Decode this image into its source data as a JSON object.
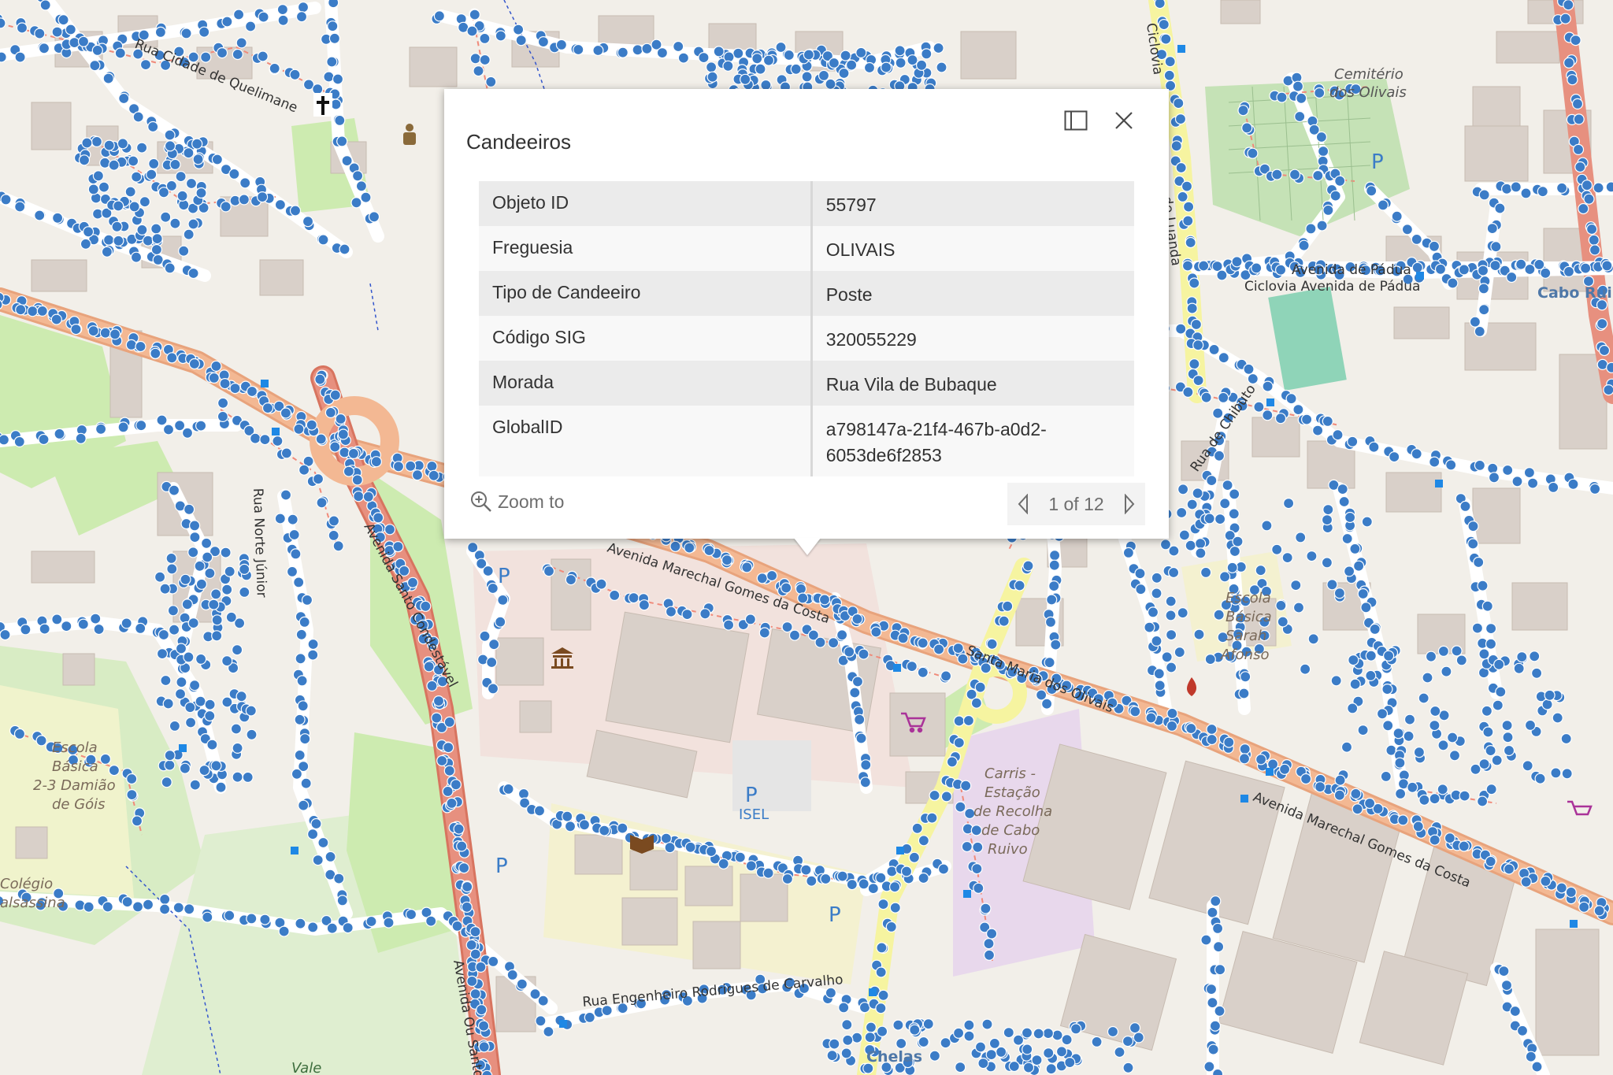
{
  "popup": {
    "title": "Candeeiros",
    "dock_icon": "dock-icon",
    "close_icon": "close-icon",
    "fields": [
      {
        "key": "Objeto ID",
        "value": "55797"
      },
      {
        "key": "Freguesia",
        "value": "OLIVAIS"
      },
      {
        "key": "Tipo de Candeeiro",
        "value": "Poste"
      },
      {
        "key": "Código SIG",
        "value": "320055229"
      },
      {
        "key": "Morada",
        "value": "Rua Vila de Bubaque"
      },
      {
        "key": "GlobalID",
        "value": "a798147a-21f4-467b-a0d2-6053de6f2853"
      }
    ],
    "zoom_to_label": "Zoom to",
    "zoom_icon": "zoom-in-icon",
    "pager_text": "1 of 12",
    "prev_icon": "chevron-left-icon",
    "next_icon": "chevron-right-icon"
  },
  "map": {
    "labels": {
      "cemiterio": "Cemitério",
      "cemiterio2": "dos Olivais",
      "escola_sarah_1": "Escola",
      "escola_sarah_2": "Básica",
      "escola_sarah_3": "Sarah",
      "escola_sarah_4": "Afonso",
      "escola_damiao_1": "Escola",
      "escola_damiao_2": "Básica",
      "escola_damiao_3": "2-3 Damião",
      "escola_damiao_4": "de Góis",
      "colegio_1": "Colégio",
      "colegio_2": "alsassina",
      "carris_1": "Carris -",
      "carris_2": "Estação",
      "carris_3": "de Recolha",
      "carris_4": "de Cabo",
      "carris_5": "Ruivo",
      "isel": "ISEL",
      "cabo_ruivo": "Cabo Rui",
      "chelas": "Chelas",
      "vale": "Vale",
      "av_padua": "Avenida de Pádua",
      "ciclovia_padua": "Ciclovia Avenida de Pádua",
      "av_marechal_1": "Avenida Marechal Gomes da Costa",
      "av_marechal_2": "Avenida Marechal Gomes da Costa",
      "rua_eng": "Rua Engenheiro Rodrigues de Carvalho",
      "av_santo_condestavel": "Avenida Santo Condestável",
      "av_ou_santo": "Avenida Ou Santo",
      "rua_norte_junior": "Rua Norte Júnior",
      "rua_chibuto": "Rua de Chibuto",
      "rua_quelimane": "Rua Cidade de Quelimane",
      "ciclovia_luanda": "Ciclovia",
      "av_luanda": "de Luanda",
      "santa_maria_olivais": "Santa Maria dos Olivais",
      "parking": "P"
    },
    "colors": {
      "background": "#f2efe9",
      "building": "#d9d0c9",
      "park": "#cdebb0",
      "primary_road": "#f3b893",
      "trunk_road": "#e7907f",
      "yellow_road": "#f6f4a0",
      "point": "#3b7cc7"
    }
  }
}
